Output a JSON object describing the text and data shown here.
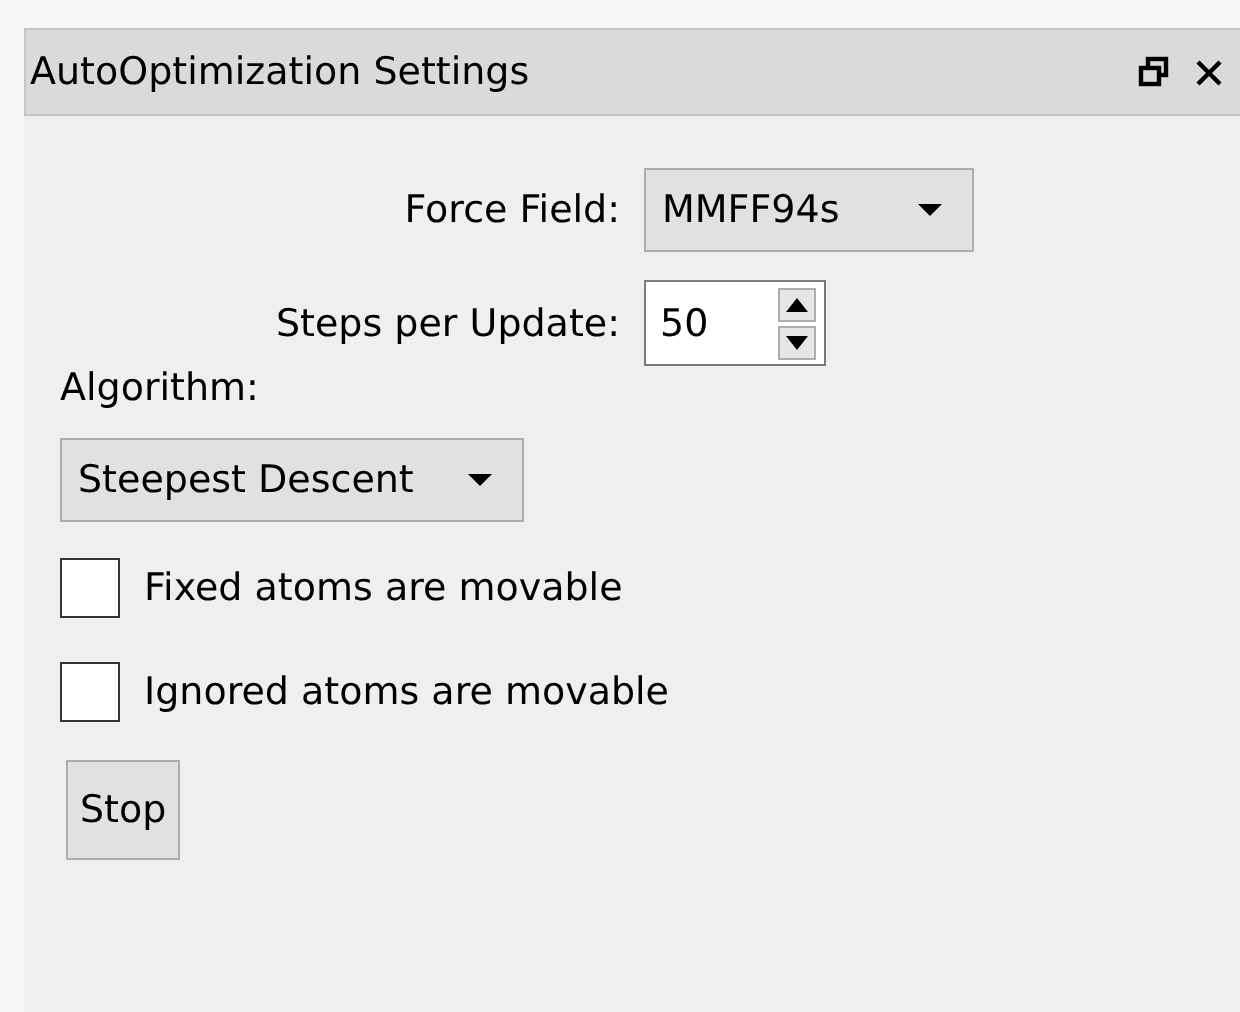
{
  "panel": {
    "title": "AutoOptimization Settings"
  },
  "force_field": {
    "label": "Force Field:",
    "value": "MMFF94s"
  },
  "steps_per_update": {
    "label": "Steps per Update:",
    "value": "50"
  },
  "algorithm": {
    "label": "Algorithm:",
    "value": "Steepest Descent"
  },
  "options": [
    {
      "label": "Fixed atoms are movable",
      "checked": false
    },
    {
      "label": "Ignored atoms are movable",
      "checked": false
    }
  ],
  "button": {
    "label": "Stop"
  }
}
